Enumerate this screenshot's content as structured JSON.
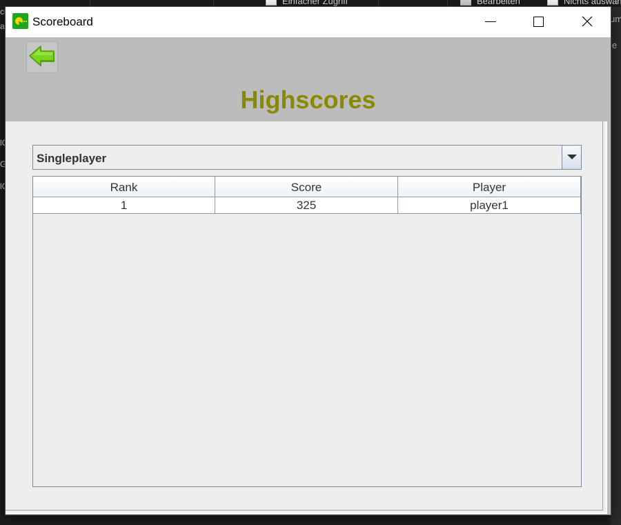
{
  "background": {
    "check_label_1": "Einfacher Zugriff",
    "check_label_2": "Bearbeiten",
    "check_label_3": "Nichts auswählen",
    "left_fragments": [
      "cl",
      "ac",
      "lC",
      "G",
      "lC"
    ],
    "right_fragments": [
      "um",
      "le"
    ]
  },
  "window": {
    "title": "Scoreboard"
  },
  "header": {
    "title": "Highscores"
  },
  "mode_select": {
    "selected": "Singleplayer"
  },
  "table": {
    "columns": [
      "Rank",
      "Score",
      "Player"
    ],
    "rows": [
      {
        "rank": "1",
        "score": "325",
        "player": "player1"
      }
    ]
  },
  "colors": {
    "heading": "#8a8a00",
    "back_arrow": "#7dd321",
    "app_icon": "#1fa51f"
  }
}
